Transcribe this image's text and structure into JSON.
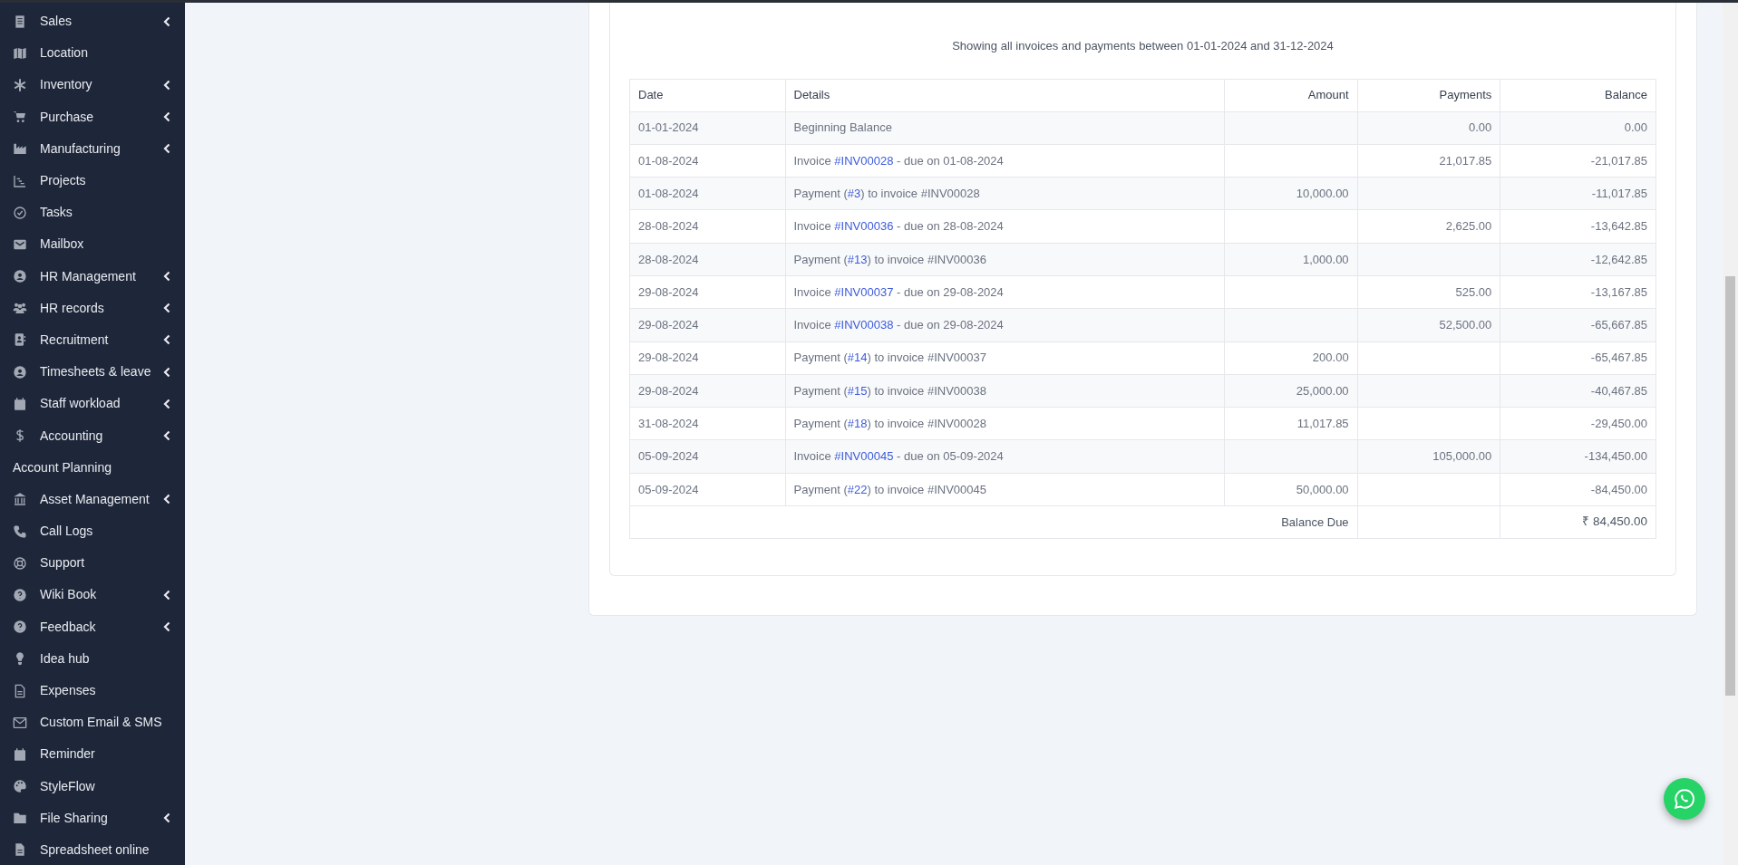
{
  "sidebar": {
    "items": [
      {
        "label": "Sales",
        "expandable": true
      },
      {
        "label": "Location",
        "expandable": false
      },
      {
        "label": "Inventory",
        "expandable": true
      },
      {
        "label": "Purchase",
        "expandable": true
      },
      {
        "label": "Manufacturing",
        "expandable": true
      },
      {
        "label": "Projects",
        "expandable": false
      },
      {
        "label": "Tasks",
        "expandable": false
      },
      {
        "label": "Mailbox",
        "expandable": false
      },
      {
        "label": "HR Management",
        "expandable": true
      },
      {
        "label": "HR records",
        "expandable": true
      },
      {
        "label": "Recruitment",
        "expandable": true
      },
      {
        "label": "Timesheets & leave",
        "expandable": true
      },
      {
        "label": "Staff workload",
        "expandable": true
      },
      {
        "label": "Accounting",
        "expandable": true
      },
      {
        "label": "Account Planning",
        "expandable": false
      },
      {
        "label": "Asset Management",
        "expandable": true
      },
      {
        "label": "Call Logs",
        "expandable": false
      },
      {
        "label": "Support",
        "expandable": false
      },
      {
        "label": "Wiki Book",
        "expandable": true
      },
      {
        "label": "Feedback",
        "expandable": true
      },
      {
        "label": "Idea hub",
        "expandable": false
      },
      {
        "label": "Expenses",
        "expandable": false
      },
      {
        "label": "Custom Email & SMS",
        "expandable": false
      },
      {
        "label": "Reminder",
        "expandable": false
      },
      {
        "label": "StyleFlow",
        "expandable": false
      },
      {
        "label": "File Sharing",
        "expandable": true
      },
      {
        "label": "Spreadsheet online",
        "expandable": false
      }
    ]
  },
  "statement": {
    "caption": "Showing all invoices and payments between 01-01-2024 and 31-12-2024",
    "columns": [
      "Date",
      "Details",
      "Amount",
      "Payments",
      "Balance"
    ],
    "rows": [
      {
        "date": "01-01-2024",
        "details": {
          "prefix": "Beginning Balance"
        },
        "amount": "",
        "payments": "0.00",
        "balance": "0.00"
      },
      {
        "date": "01-08-2024",
        "details": {
          "prefix": "Invoice ",
          "link": "#INV00028",
          "suffix": " - due on 01-08-2024"
        },
        "amount": "",
        "payments": "21,017.85",
        "balance": "-21,017.85"
      },
      {
        "date": "01-08-2024",
        "details": {
          "prefix": "Payment (",
          "link": "#3",
          "suffix": ") to invoice #INV00028"
        },
        "amount": "10,000.00",
        "payments": "",
        "balance": "-11,017.85"
      },
      {
        "date": "28-08-2024",
        "details": {
          "prefix": "Invoice ",
          "link": "#INV00036",
          "suffix": " - due on 28-08-2024"
        },
        "amount": "",
        "payments": "2,625.00",
        "balance": "-13,642.85"
      },
      {
        "date": "28-08-2024",
        "details": {
          "prefix": "Payment (",
          "link": "#13",
          "suffix": ") to invoice #INV00036"
        },
        "amount": "1,000.00",
        "payments": "",
        "balance": "-12,642.85"
      },
      {
        "date": "29-08-2024",
        "details": {
          "prefix": "Invoice ",
          "link": "#INV00037",
          "suffix": " - due on 29-08-2024"
        },
        "amount": "",
        "payments": "525.00",
        "balance": "-13,167.85"
      },
      {
        "date": "29-08-2024",
        "details": {
          "prefix": "Invoice ",
          "link": "#INV00038",
          "suffix": " - due on 29-08-2024"
        },
        "amount": "",
        "payments": "52,500.00",
        "balance": "-65,667.85"
      },
      {
        "date": "29-08-2024",
        "details": {
          "prefix": "Payment (",
          "link": "#14",
          "suffix": ") to invoice #INV00037"
        },
        "amount": "200.00",
        "payments": "",
        "balance": "-65,467.85"
      },
      {
        "date": "29-08-2024",
        "details": {
          "prefix": "Payment (",
          "link": "#15",
          "suffix": ") to invoice #INV00038"
        },
        "amount": "25,000.00",
        "payments": "",
        "balance": "-40,467.85"
      },
      {
        "date": "31-08-2024",
        "details": {
          "prefix": "Payment (",
          "link": "#18",
          "suffix": ") to invoice #INV00028"
        },
        "amount": "11,017.85",
        "payments": "",
        "balance": "-29,450.00"
      },
      {
        "date": "05-09-2024",
        "details": {
          "prefix": "Invoice ",
          "link": "#INV00045",
          "suffix": " - due on 05-09-2024"
        },
        "amount": "",
        "payments": "105,000.00",
        "balance": "-134,450.00"
      },
      {
        "date": "05-09-2024",
        "details": {
          "prefix": "Payment (",
          "link": "#22",
          "suffix": ") to invoice #INV00045"
        },
        "amount": "50,000.00",
        "payments": "",
        "balance": "-84,450.00"
      }
    ],
    "total": {
      "label": "Balance Due",
      "value": "₹ 84,450.00"
    }
  }
}
